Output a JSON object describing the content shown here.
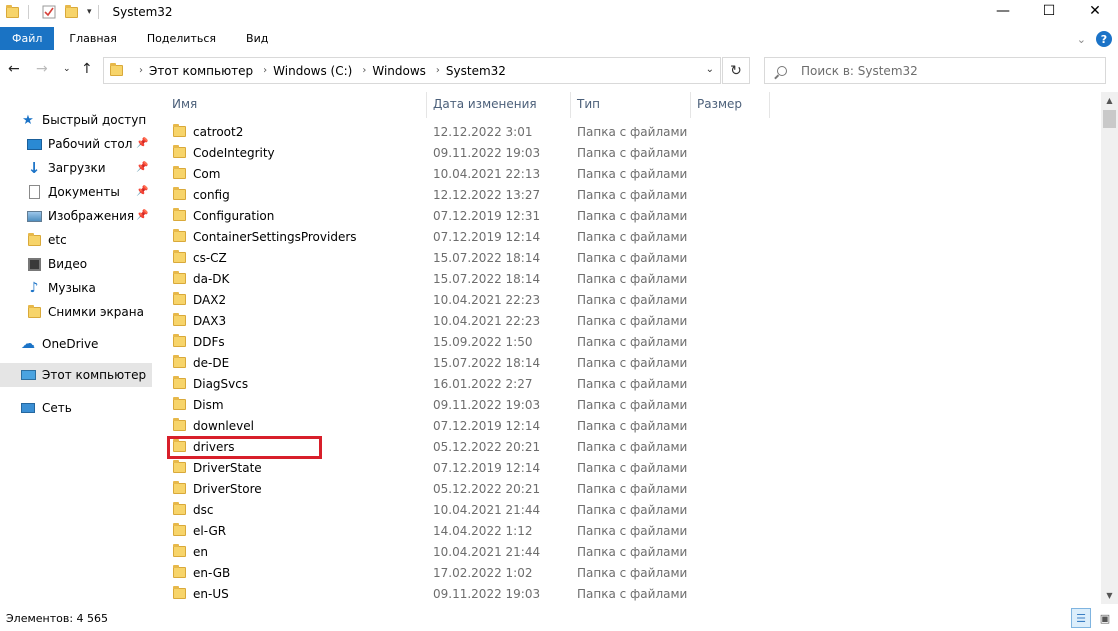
{
  "title": "System32",
  "window_controls": {
    "minimize": "—",
    "maximize": "☐",
    "close": "✕"
  },
  "ribbon": {
    "tabs": [
      "Файл",
      "Главная",
      "Поделиться",
      "Вид"
    ],
    "help": "?"
  },
  "address": {
    "breadcrumbs": [
      "Этот компьютер",
      "Windows (C:)",
      "Windows",
      "System32"
    ]
  },
  "search": {
    "placeholder": "Поиск в: System32"
  },
  "nav": {
    "quick_access": "Быстрый доступ",
    "items": [
      {
        "label": "Рабочий стол",
        "icon": "desktop-icon",
        "pinned": true
      },
      {
        "label": "Загрузки",
        "icon": "downloads-icon",
        "pinned": true
      },
      {
        "label": "Документы",
        "icon": "documents-icon",
        "pinned": true
      },
      {
        "label": "Изображения",
        "icon": "pictures-icon",
        "pinned": true
      },
      {
        "label": "etc",
        "icon": "folder-icon",
        "pinned": false
      },
      {
        "label": "Видео",
        "icon": "videos-icon",
        "pinned": false
      },
      {
        "label": "Музыка",
        "icon": "music-icon",
        "pinned": false
      },
      {
        "label": "Снимки экрана",
        "icon": "folder-icon",
        "pinned": false
      }
    ],
    "onedrive": "OneDrive",
    "this_pc": "Этот компьютер",
    "network": "Сеть"
  },
  "columns": {
    "name": "Имя",
    "date": "Дата изменения",
    "type": "Тип",
    "size": "Размер"
  },
  "files": [
    {
      "name": "catroot2",
      "date": "12.12.2022 3:01",
      "type": "Папка с файлами"
    },
    {
      "name": "CodeIntegrity",
      "date": "09.11.2022 19:03",
      "type": "Папка с файлами"
    },
    {
      "name": "Com",
      "date": "10.04.2021 22:13",
      "type": "Папка с файлами"
    },
    {
      "name": "config",
      "date": "12.12.2022 13:27",
      "type": "Папка с файлами"
    },
    {
      "name": "Configuration",
      "date": "07.12.2019 12:31",
      "type": "Папка с файлами"
    },
    {
      "name": "ContainerSettingsProviders",
      "date": "07.12.2019 12:14",
      "type": "Папка с файлами"
    },
    {
      "name": "cs-CZ",
      "date": "15.07.2022 18:14",
      "type": "Папка с файлами"
    },
    {
      "name": "da-DK",
      "date": "15.07.2022 18:14",
      "type": "Папка с файлами"
    },
    {
      "name": "DAX2",
      "date": "10.04.2021 22:23",
      "type": "Папка с файлами"
    },
    {
      "name": "DAX3",
      "date": "10.04.2021 22:23",
      "type": "Папка с файлами"
    },
    {
      "name": "DDFs",
      "date": "15.09.2022 1:50",
      "type": "Папка с файлами"
    },
    {
      "name": "de-DE",
      "date": "15.07.2022 18:14",
      "type": "Папка с файлами"
    },
    {
      "name": "DiagSvcs",
      "date": "16.01.2022 2:27",
      "type": "Папка с файлами"
    },
    {
      "name": "Dism",
      "date": "09.11.2022 19:03",
      "type": "Папка с файлами"
    },
    {
      "name": "downlevel",
      "date": "07.12.2019 12:14",
      "type": "Папка с файлами"
    },
    {
      "name": "drivers",
      "date": "05.12.2022 20:21",
      "type": "Папка с файлами"
    },
    {
      "name": "DriverState",
      "date": "07.12.2019 12:14",
      "type": "Папка с файлами"
    },
    {
      "name": "DriverStore",
      "date": "05.12.2022 20:21",
      "type": "Папка с файлами"
    },
    {
      "name": "dsc",
      "date": "10.04.2021 21:44",
      "type": "Папка с файлами"
    },
    {
      "name": "el-GR",
      "date": "14.04.2022 1:12",
      "type": "Папка с файлами"
    },
    {
      "name": "en",
      "date": "10.04.2021 21:44",
      "type": "Папка с файлами"
    },
    {
      "name": "en-GB",
      "date": "17.02.2022 1:02",
      "type": "Папка с файлами"
    },
    {
      "name": "en-US",
      "date": "09.11.2022 19:03",
      "type": "Папка с файлами"
    }
  ],
  "status": {
    "item_count": "Элементов: 4 565"
  },
  "colors": {
    "accent": "#1a73c4",
    "highlight": "#d81f2a",
    "folder": "#f7d46a"
  }
}
